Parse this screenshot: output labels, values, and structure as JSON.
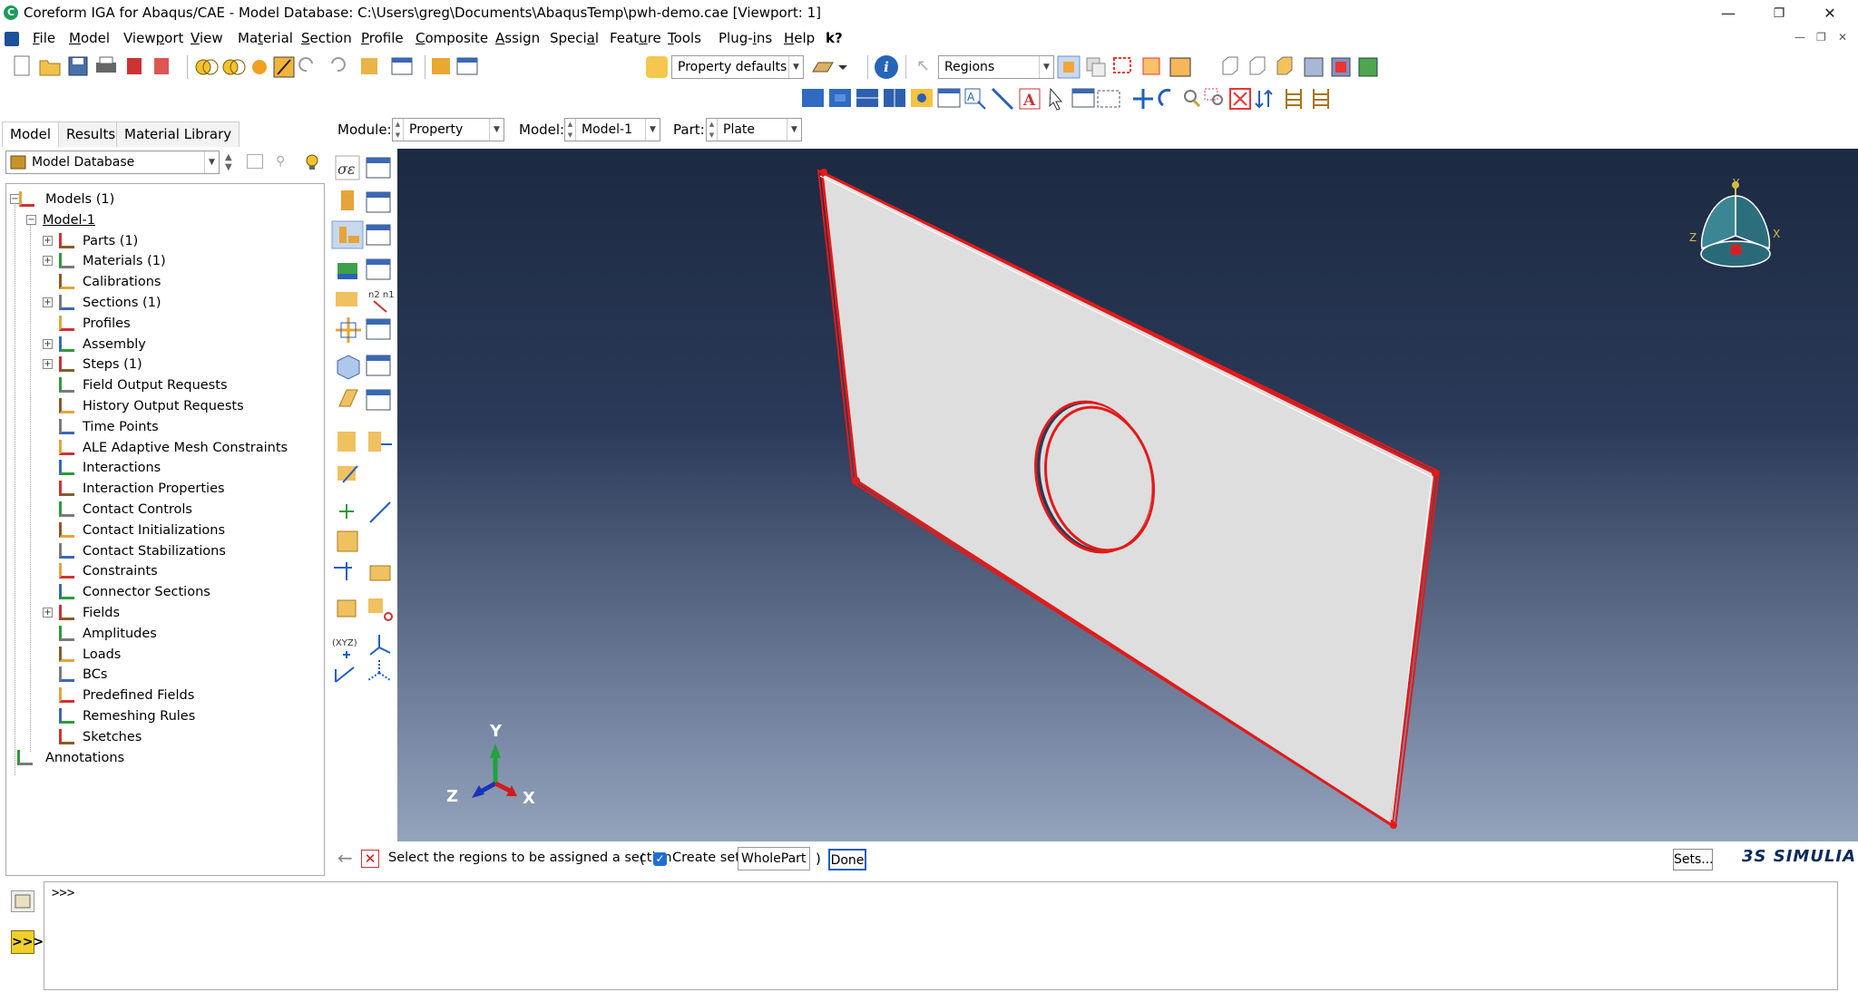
{
  "window": {
    "title": "Coreform IGA for Abaqus/CAE - Model Database: C:\\Users\\greg\\Documents\\AbaqusTemp\\pwh-demo.cae [Viewport: 1]",
    "minimize": "—",
    "restore": "❐",
    "close": "✕"
  },
  "menubar": {
    "items": [
      {
        "label": "File",
        "u": "F",
        "rest": "ile"
      },
      {
        "label": "Model",
        "u": "M",
        "rest": "odel"
      },
      {
        "label": "Viewport",
        "pre": "View",
        "u": "p",
        "rest": "ort"
      },
      {
        "label": "View",
        "u": "V",
        "rest": "iew"
      },
      {
        "label": "Material",
        "pre": "Ma",
        "u": "t",
        "rest": "erial"
      },
      {
        "label": "Section",
        "u": "S",
        "rest": "ection"
      },
      {
        "label": "Profile",
        "u": "P",
        "rest": "rofile"
      },
      {
        "label": "Composite",
        "u": "C",
        "rest": "omposite"
      },
      {
        "label": "Assign",
        "u": "A",
        "rest": "ssign"
      },
      {
        "label": "Special",
        "pre": "Speci",
        "u": "a",
        "rest": "l"
      },
      {
        "label": "Feature",
        "pre": "Feat",
        "u": "u",
        "rest": "re"
      },
      {
        "label": "Tools",
        "u": "T",
        "rest": "ools"
      },
      {
        "label": "Plug-ins",
        "pre": "Plug-",
        "u": "i",
        "rest": "ns"
      },
      {
        "label": "Help",
        "u": "H",
        "rest": "elp"
      }
    ],
    "whatsthis": "k?"
  },
  "toolbar": {
    "property_defaults": "Property defaults",
    "selection_filter": "Regions"
  },
  "tabs": [
    "Model",
    "Results",
    "Material Library"
  ],
  "tree_header": "Model Database",
  "tree": [
    {
      "label": "Models (1)",
      "level": 0,
      "exp": "−",
      "icon": "models-icon"
    },
    {
      "label": "Model-1",
      "level": 1,
      "exp": "−",
      "icon": "",
      "underline": true
    },
    {
      "label": "Parts (1)",
      "level": 2,
      "exp": "+",
      "icon": "parts-icon"
    },
    {
      "label": "Materials (1)",
      "level": 2,
      "exp": "+",
      "icon": "materials-icon"
    },
    {
      "label": "Calibrations",
      "level": 2,
      "icon": "calibrations-icon"
    },
    {
      "label": "Sections (1)",
      "level": 2,
      "exp": "+",
      "icon": "sections-icon"
    },
    {
      "label": "Profiles",
      "level": 2,
      "icon": "profiles-icon"
    },
    {
      "label": "Assembly",
      "level": 2,
      "exp": "+",
      "icon": "assembly-icon"
    },
    {
      "label": "Steps (1)",
      "level": 2,
      "exp": "+",
      "icon": "steps-icon"
    },
    {
      "label": "Field Output Requests",
      "level": 2,
      "icon": "field-output-icon"
    },
    {
      "label": "History Output Requests",
      "level": 2,
      "icon": "history-output-icon"
    },
    {
      "label": "Time Points",
      "level": 2,
      "icon": "time-points-icon"
    },
    {
      "label": "ALE Adaptive Mesh Constraints",
      "level": 2,
      "icon": "ale-icon"
    },
    {
      "label": "Interactions",
      "level": 2,
      "icon": "interactions-icon"
    },
    {
      "label": "Interaction Properties",
      "level": 2,
      "icon": "interaction-properties-icon"
    },
    {
      "label": "Contact Controls",
      "level": 2,
      "icon": "contact-controls-icon"
    },
    {
      "label": "Contact Initializations",
      "level": 2,
      "icon": "contact-init-icon"
    },
    {
      "label": "Contact Stabilizations",
      "level": 2,
      "icon": "contact-stab-icon"
    },
    {
      "label": "Constraints",
      "level": 2,
      "icon": "constraints-icon"
    },
    {
      "label": "Connector Sections",
      "level": 2,
      "icon": "connector-icon"
    },
    {
      "label": "Fields",
      "level": 2,
      "exp": "+",
      "icon": "fields-icon"
    },
    {
      "label": "Amplitudes",
      "level": 2,
      "icon": "amplitudes-icon"
    },
    {
      "label": "Loads",
      "level": 2,
      "icon": "loads-icon"
    },
    {
      "label": "BCs",
      "level": 2,
      "icon": "bcs-icon"
    },
    {
      "label": "Predefined Fields",
      "level": 2,
      "icon": "predefined-icon"
    },
    {
      "label": "Remeshing Rules",
      "level": 2,
      "icon": "remeshing-icon"
    },
    {
      "label": "Sketches",
      "level": 2,
      "icon": "sketches-icon"
    },
    {
      "label": "Annotations",
      "level": 0,
      "icon": "annotations-icon"
    }
  ],
  "context": {
    "module_label": "Module:",
    "module_value": "Property",
    "model_label": "Model:",
    "model_value": "Model-1",
    "part_label": "Part:",
    "part_value": "Plate"
  },
  "triad": {
    "x": "X",
    "y": "Y",
    "z": "Z"
  },
  "prompt": {
    "text": "Select the regions to be assigned a section",
    "open_paren": "(",
    "create_set_label": "Create set:",
    "set_name": "WholePart",
    "close_paren": ")",
    "done_label": "Done",
    "sets_label": "Sets...",
    "brand": "SIMULIA"
  },
  "command": {
    "prompt": ">>>"
  },
  "colors": {
    "viewport_top": "#1c2941",
    "viewport_bottom": "#93a3bb",
    "highlight": "#ff1a1a",
    "plate": "#dcdcdc"
  }
}
